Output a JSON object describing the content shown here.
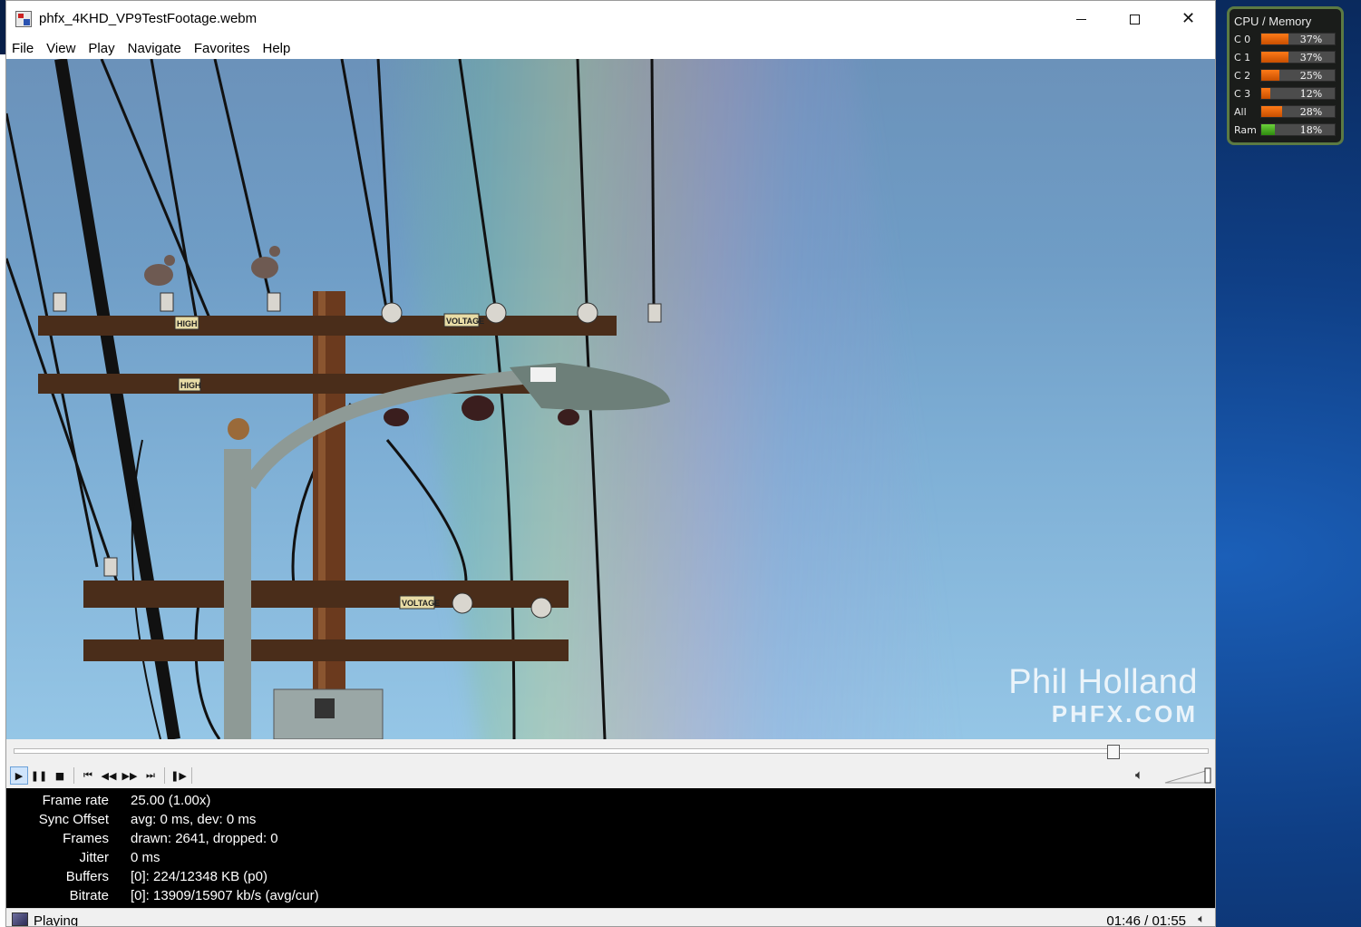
{
  "window": {
    "title": "phfx_4KHD_VP9TestFootage.webm",
    "minimize_label": "",
    "maximize_label": "",
    "close_label": "✕"
  },
  "menu": {
    "items": [
      "File",
      "View",
      "Play",
      "Navigate",
      "Favorites",
      "Help"
    ]
  },
  "video": {
    "watermark_name": "Phil Holland",
    "watermark_site": "PHFX.COM",
    "pole_signs": [
      "HIGH",
      "VOLTAGE",
      "HIGH",
      "VOLTAGE",
      "VOLTAGE"
    ]
  },
  "playback": {
    "seek_position": 0.92,
    "volume_level": 1.0,
    "buttons": [
      "play",
      "pause",
      "stop",
      "previous",
      "rewind",
      "fast-forward",
      "next",
      "frame-step"
    ]
  },
  "stats": [
    {
      "label": "Frame rate",
      "value": "25.00 (1.00x)"
    },
    {
      "label": "Sync Offset",
      "value": "avg: 0 ms, dev: 0 ms"
    },
    {
      "label": "Frames",
      "value": "drawn: 2641, dropped: 0"
    },
    {
      "label": "Jitter",
      "value": "0 ms"
    },
    {
      "label": "Buffers",
      "value": "[0]: 224/12348 KB (p0)"
    },
    {
      "label": "Bitrate",
      "value": "[0]: 13909/15907 kb/s (avg/cur)"
    }
  ],
  "status": {
    "state": "Playing",
    "time": "01:46 / 01:55"
  },
  "gadget": {
    "title": "CPU / Memory",
    "rows": [
      {
        "label": "C 0",
        "value": "37%",
        "percent": 37,
        "kind": "cpu"
      },
      {
        "label": "C 1",
        "value": "37%",
        "percent": 37,
        "kind": "cpu"
      },
      {
        "label": "C 2",
        "value": "25%",
        "percent": 25,
        "kind": "cpu"
      },
      {
        "label": "C 3",
        "value": "12%",
        "percent": 12,
        "kind": "cpu"
      },
      {
        "label": "All",
        "value": "28%",
        "percent": 28,
        "kind": "cpu"
      },
      {
        "label": "Ram",
        "value": "18%",
        "percent": 18,
        "kind": "ram"
      }
    ],
    "colors": {
      "cpu": "#e06a10",
      "ram": "#4cae1f",
      "border": "#5c7a43"
    }
  }
}
